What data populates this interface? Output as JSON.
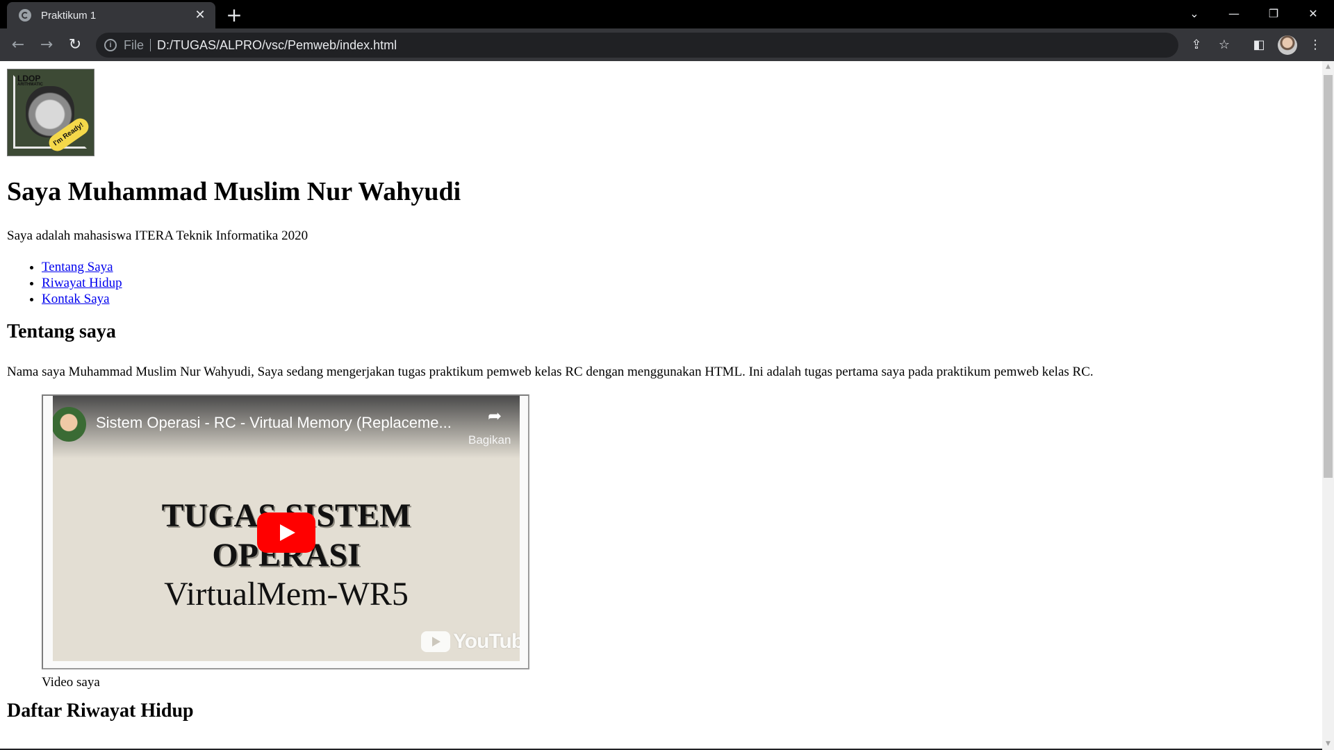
{
  "browser": {
    "tab_title": "Praktikum 1",
    "file_label": "File",
    "url": "D:/TUGAS/ALPRO/vsc/Pemweb/index.html"
  },
  "page": {
    "heading": "Saya Muhammad Muslim Nur Wahyudi",
    "intro": "Saya adalah mahasiswa ITERA Teknik Informatika 2020",
    "nav_links": [
      "Tentang Saya",
      "Riwayat Hidup",
      "Kontak Saya"
    ],
    "about_heading": "Tentang saya",
    "about_text": "Nama saya Muhammad Muslim Nur Wahyudi, Saya sedang mengerjakan tugas praktikum pemweb kelas RC dengan menggunakan HTML. Ini adalah tugas pertama saya pada praktikum pemweb kelas RC.",
    "video": {
      "title": "Sistem Operasi - RC - Virtual Memory (Replaceme...",
      "share_label": "Bagikan",
      "thumbnail_line1": "TUGAS SISTEM",
      "thumbnail_line2": "OPERASI",
      "thumbnail_line3": "VirtualMem-WR5",
      "platform_logo": "YouTube"
    },
    "video_caption": "Video saya",
    "cv_heading": "Daftar Riwayat Hidup",
    "profile_image": {
      "text_top": "LDOP",
      "text_sub": "ARITHMATIC",
      "badge": "I'm Ready!"
    }
  },
  "colors": {
    "link": "#0000ee",
    "youtube_red": "#ff0000",
    "chrome_dark": "#35363a"
  }
}
